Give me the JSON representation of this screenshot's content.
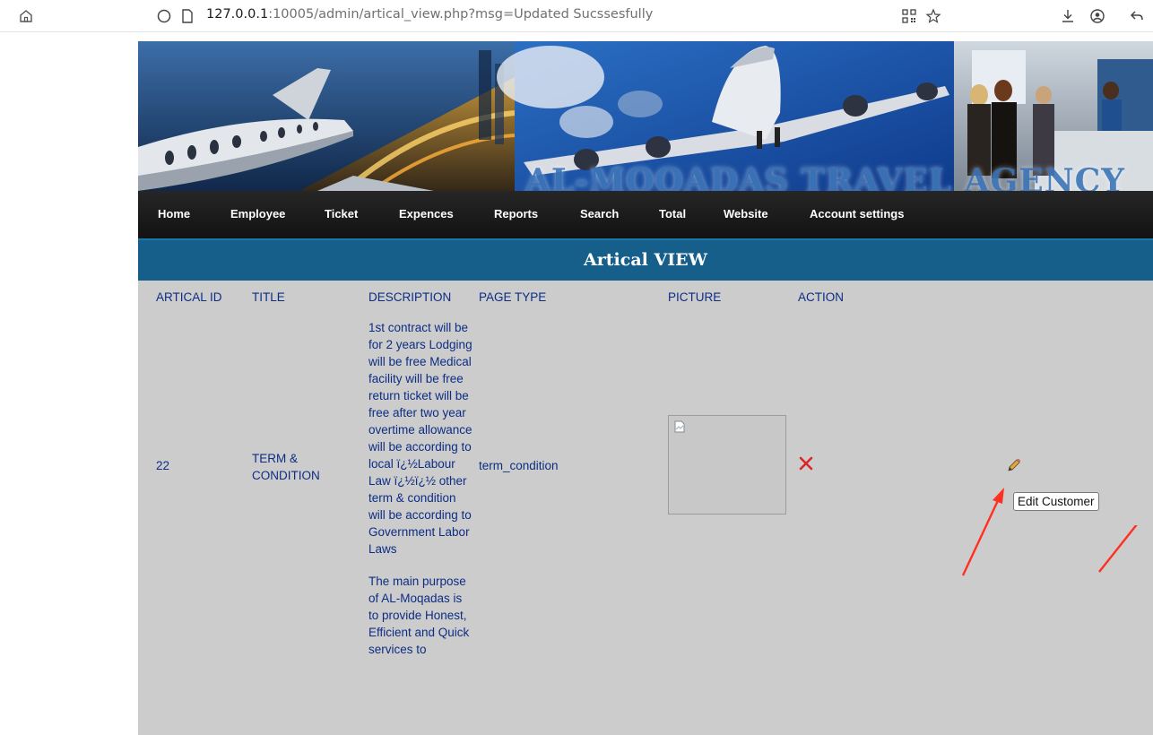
{
  "browser": {
    "url_host": "127.0.0.1",
    "url_rest": ":10005/admin/artical_view.php?msg=Updated Sucssesfully",
    "icons": [
      "home-icon",
      "shield-icon",
      "page-icon",
      "qr-icon",
      "star-icon",
      "download-icon",
      "account-icon",
      "back-icon"
    ]
  },
  "banner": {
    "title": "AL-MOQADAS TRAVEL AGENCY"
  },
  "nav": {
    "items": [
      "Home",
      "Employee",
      "Ticket",
      "Expences",
      "Reports",
      "Search",
      "Total",
      "Website",
      "Account settings"
    ]
  },
  "page": {
    "title": "Artical VIEW"
  },
  "table": {
    "headers": [
      "ARTICAL ID",
      "TITLE",
      "DESCRIPTION",
      "PAGE TYPE",
      "PICTURE",
      "ACTION"
    ],
    "row": {
      "id": "22",
      "title": "TERM & CONDITION",
      "description_1": "1st contract will be for 2 years Lodging will be free Medical facility will be free return ticket will be free after two year overtime allowance will be according to local ï¿½Labour Law ï¿½ï¿½ other term & condition will be according to Government Labor Laws",
      "description_2": "The main purpose of AL-Moqadas is to provide Honest, Efficient and Quick services to",
      "page_type": "term_condition"
    }
  },
  "tooltip": {
    "text": "Edit Customer"
  },
  "colors": {
    "content_bg": "#cccccc",
    "title_bar": "#155f8a",
    "nav_bg": "#1c1c1c",
    "table_text": "#0c2d83",
    "delete_red": "#d9262b",
    "arrow_red": "#ff3020"
  }
}
